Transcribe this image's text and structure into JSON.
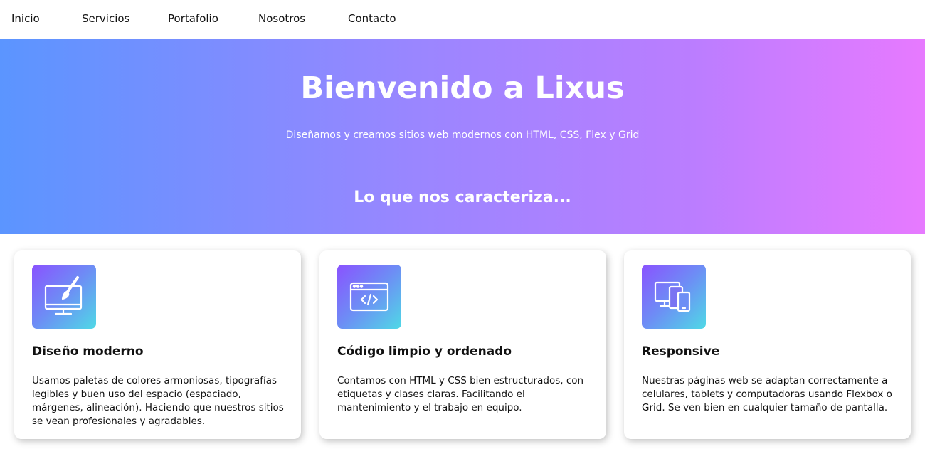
{
  "nav": {
    "items": [
      "Inicio",
      "Servicios",
      "Portafolio",
      "Nosotros",
      "Contacto"
    ]
  },
  "hero": {
    "title": "Bienvenido a Lixus",
    "subtitle": "Diseñamos y creamos sitios web modernos con HTML, CSS, Flex y Grid",
    "section_title": "Lo que nos caracteriza..."
  },
  "cards": [
    {
      "icon": "monitor-paintbrush-icon",
      "title": "Diseño moderno",
      "text": "Usamos paletas de colores armoniosas, tipografías legibles y buen uso del espacio (espaciado, márgenes, alineación). Haciendo que nuestros sitios se vean profesionales y agradables."
    },
    {
      "icon": "code-window-icon",
      "title": "Código limpio y ordenado",
      "text": "Contamos con HTML y CSS bien estructurados, con etiquetas y clases claras. Facilitando el mantenimiento y el trabajo en equipo."
    },
    {
      "icon": "responsive-devices-icon",
      "title": "Responsive",
      "text": "Nuestras páginas web se adaptan correctamente a celulares, tablets y computadoras usando Flexbox o Grid. Se ven bien en cualquier tamaño de pantalla."
    }
  ],
  "colors": {
    "hero_gradient_start": "#5b95ff",
    "hero_gradient_end": "#e77aff",
    "icon_gradient_start": "#8a52ff",
    "icon_gradient_end": "#4fd9e6"
  }
}
